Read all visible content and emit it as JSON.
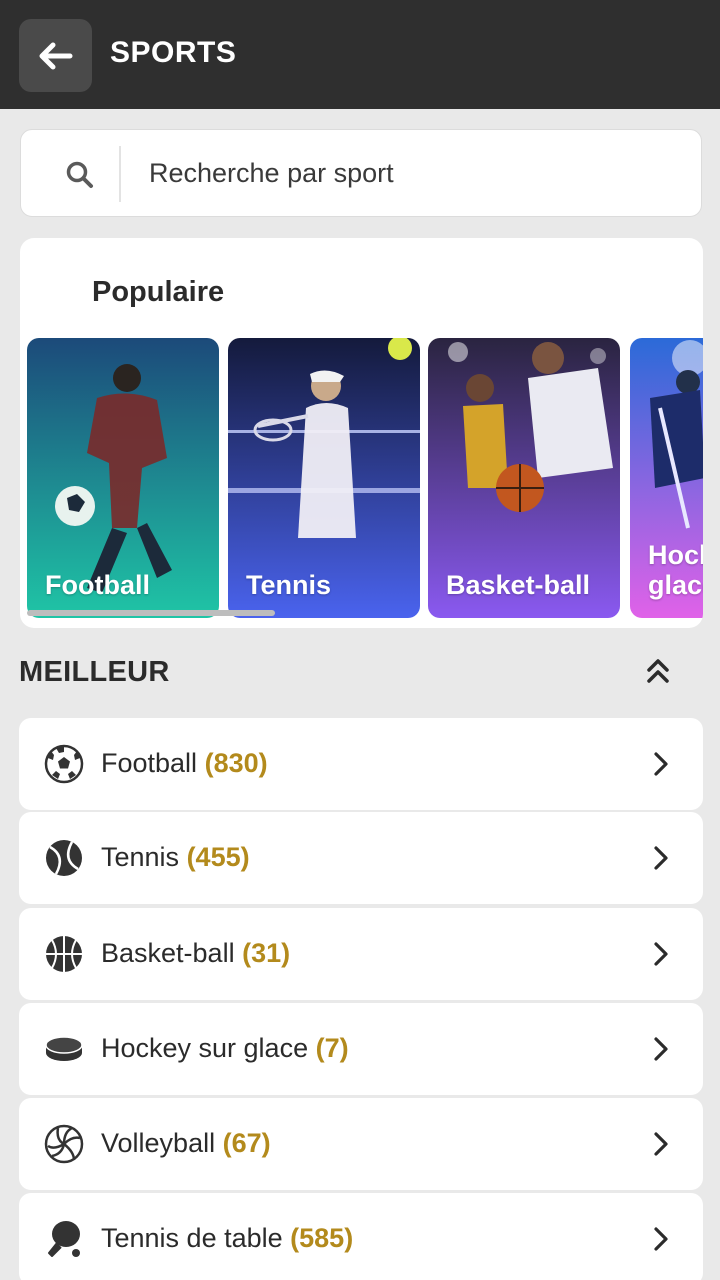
{
  "header": {
    "title": "SPORTS",
    "back_icon": "arrow-left-icon"
  },
  "search": {
    "placeholder": "Recherche par sport",
    "icon": "search-icon"
  },
  "popular": {
    "title": "Populaire",
    "tiles": [
      {
        "label": "Football",
        "gradient_top": "#1c4a7a",
        "gradient_bottom": "#1fc5a6"
      },
      {
        "label": "Tennis",
        "gradient_top": "#141a3c",
        "gradient_bottom": "#4a63ee"
      },
      {
        "label": "Basket-ball",
        "gradient_top": "#2a2440",
        "gradient_bottom": "#8a59f0"
      },
      {
        "label": "Hockey sur glace",
        "gradient_top": "#2b6ad8",
        "gradient_bottom": "#e062e8"
      }
    ],
    "scroll_progress": 0.37
  },
  "best": {
    "title": "MEILLEUR",
    "collapse_icon": "double-chevron-up-icon",
    "items": [
      {
        "name": "Football",
        "count": "(830)",
        "icon": "soccer-ball-icon"
      },
      {
        "name": "Tennis",
        "count": "(455)",
        "icon": "tennis-ball-icon"
      },
      {
        "name": "Basket-ball",
        "count": "(31)",
        "icon": "basketball-icon"
      },
      {
        "name": "Hockey sur glace",
        "count": "(7)",
        "icon": "hockey-puck-icon"
      },
      {
        "name": "Volleyball",
        "count": "(67)",
        "icon": "volleyball-icon"
      },
      {
        "name": "Tennis de table",
        "count": "(585)",
        "icon": "table-tennis-icon"
      }
    ]
  },
  "colors": {
    "header_bg": "#2f2f2f",
    "count_accent": "#b38a1c",
    "page_bg": "#e9e9e9"
  }
}
